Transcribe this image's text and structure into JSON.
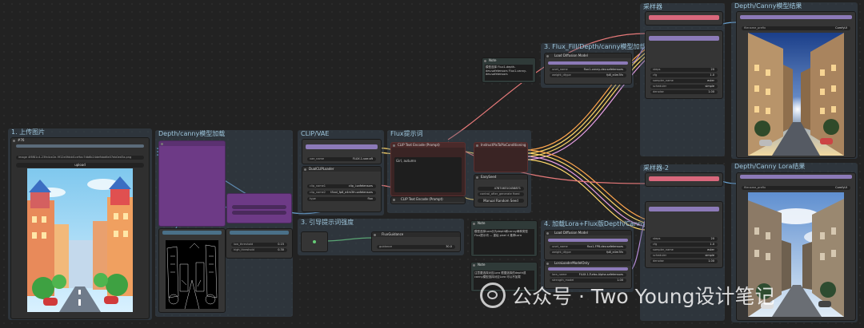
{
  "groups": {
    "upload": "1. 上传图片",
    "depth": "Depth/canny模型加载",
    "clip": "CLIP/VAE",
    "prompt": "Flux提示词",
    "guide": "3. 引导提示词强度",
    "fluxdepth": "3. Flux_Fill/Depth/canny模型加载",
    "loraload": "4. 加载Lora+Flux版Depth/Canny",
    "sample1": "采样器",
    "sample2": "采样器-2",
    "save1": "Depth/Canny模型结果",
    "save2": "Depth/Canny Lora结果"
  },
  "nodes": {
    "load_image": {
      "title": "#76",
      "image_value": "image 4f8f81c4-23fe4ce2e-9f12e0fddd1ce9ac7db6b24defbbd6e07eb0ed3a.png",
      "upload": "upload"
    },
    "clip_loader": {
      "title": "DualCLIPLoader",
      "clip_name1": "clip_l.safetensors",
      "clip_name2": "t5xxl_fp8_e4m3fn.safetensors",
      "type": "flux"
    },
    "vae_loader": {
      "title": "VAE Loader",
      "vae_name": "FLUX.1-vae.sft"
    },
    "clip_text_encode": {
      "title": "CLIP Text Encode (Prompt)",
      "text": "Girl, autumn"
    },
    "clip_text_encode_neg": {
      "title": "CLIP Text Encode (Prompt)"
    },
    "instruct_pix": {
      "title": "InstructPixToPixConditioning"
    },
    "ksampler_mid": {
      "title": "EasySeed",
      "seed": "478746310458871",
      "control": "control_after_generate  fixed",
      "button": "Manual Random Seed"
    },
    "flux_guidance": {
      "title": "FluxGuidance",
      "guidance": "guidance",
      "guidance_val": "30.0"
    },
    "canny": {
      "title": "Canny",
      "low": "low_threshold",
      "low_val": "0.15",
      "high": "high_threshold",
      "high_val": "0.30"
    },
    "note1": {
      "title": "Note",
      "text": "模型选择 Flux1-depth-dev.safetensors Flux1-canny-dev.safetensors"
    },
    "note2": {
      "title": "Note",
      "text": "模型选择Lora分为depth和canny两种类型 Flux提示词 — 重绘 pixel 4 推荐Lora"
    },
    "note3": {
      "title": "Note",
      "text": "注意要选择对应Lora 根据选择的depth或canny模型选择对应Lora 可以不加载"
    },
    "load_diffusion_1": {
      "title": "Load Diffusion Model",
      "unet_name": "flux1-canny-dev.safetensors",
      "weight_dtype": "fp8_e4m3fn"
    },
    "load_diffusion_2": {
      "title": "Load Diffusion Model",
      "unet_name": "flux1-FP8-dev.safetensors",
      "weight_dtype": "fp8_e4m3fn"
    },
    "lora_loader": {
      "title": "LoraLoaderModelOnly",
      "lora_name": "FLUX.1-Turbo-Alpha.safetensors",
      "strength": "1.00"
    },
    "sampler1": {
      "title": "KSampler",
      "decode_title": "VAE Decode",
      "rows": [
        [
          "steps",
          "20"
        ],
        [
          "cfg",
          "1.0"
        ],
        [
          "sampler_name",
          "euler"
        ],
        [
          "scheduler",
          "simple"
        ],
        [
          "denoise",
          "1.00"
        ]
      ]
    },
    "sampler2": {
      "title": "KSampler",
      "decode_title": "VAE Decode",
      "rows": [
        [
          "steps",
          "20"
        ],
        [
          "cfg",
          "1.0"
        ],
        [
          "sampler_name",
          "euler"
        ],
        [
          "scheduler",
          "simple"
        ],
        [
          "denoise",
          "1.00"
        ]
      ]
    },
    "save1": {
      "title": "Save Image",
      "prefix_label": "filename_prefix",
      "prefix_val": "ComfyUI"
    },
    "save2": {
      "title": "Save Image",
      "prefix_label": "filename_prefix",
      "prefix_val": "ComfyUI"
    }
  },
  "watermark": "公众号 · Two Young设计笔记",
  "colors": {
    "accent_pink": "#d9687c",
    "accent_purple": "#8c7ab8",
    "group_blue": "#3b5566"
  }
}
